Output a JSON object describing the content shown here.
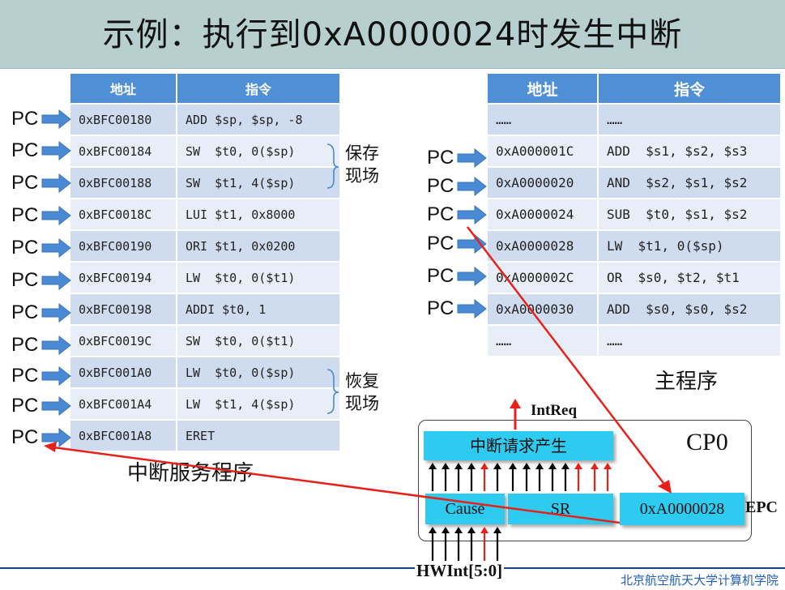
{
  "title": "示例：执行到0xA0000024时发生中断",
  "isr_table": {
    "headers": [
      "地址",
      "指令"
    ],
    "rows": [
      [
        "0xBFC00180",
        "ADD $sp, $sp, -8"
      ],
      [
        "0xBFC00184",
        "SW  $t0, 0($sp)"
      ],
      [
        "0xBFC00188",
        "SW  $t1, 4($sp)"
      ],
      [
        "0xBFC0018C",
        "LUI $t1, 0x8000"
      ],
      [
        "0xBFC00190",
        "ORI $t1, 0x0200"
      ],
      [
        "0xBFC00194",
        "LW  $t0, 0($t1)"
      ],
      [
        "0xBFC00198",
        "ADDI $t0, 1"
      ],
      [
        "0xBFC0019C",
        "SW  $t0, 0($t1)"
      ],
      [
        "0xBFC001A0",
        "LW  $t0, 0($sp)"
      ],
      [
        "0xBFC001A4",
        "LW  $t1, 4($sp)"
      ],
      [
        "0xBFC001A8",
        "ERET"
      ]
    ],
    "caption": "中断服务程序"
  },
  "main_table": {
    "headers": [
      "地址",
      "指令"
    ],
    "rows": [
      [
        "……",
        "……"
      ],
      [
        "0xA000001C",
        "ADD  $s1, $s2, $s3"
      ],
      [
        "0xA0000020",
        "AND  $s2, $s1, $s2"
      ],
      [
        "0xA0000024",
        "SUB  $t0, $s1, $s2"
      ],
      [
        "0xA0000028",
        "LW  $t1, 0($sp)"
      ],
      [
        "0xA000002C",
        "OR  $s0, $t2, $t1"
      ],
      [
        "0xA0000030",
        "ADD  $s0, $s0, $s2"
      ],
      [
        "……",
        "……"
      ]
    ],
    "caption": "主程序"
  },
  "pc_label": "PC",
  "brace_save": [
    "保存",
    "现场"
  ],
  "brace_restore": [
    "恢复",
    "现场"
  ],
  "cp0": {
    "label": "CP0",
    "intreq_label": "IntReq",
    "gen_box": "中断请求产生",
    "cause_box": "Cause",
    "sr_box": "SR",
    "epc_box": "0xA0000028",
    "epc_label": "EPC",
    "hwint_label": "HWInt[5:0]"
  },
  "footer": "北京航空航天大学计算机学院",
  "colors": {
    "header_blue": "#4f8fd6",
    "row_dark": "#cfdcef",
    "row_light": "#e7eef7",
    "cyan_box": "#2ecbf0",
    "arrow_blue": "#4a8ad4",
    "red_arrow": "#e8201a"
  }
}
